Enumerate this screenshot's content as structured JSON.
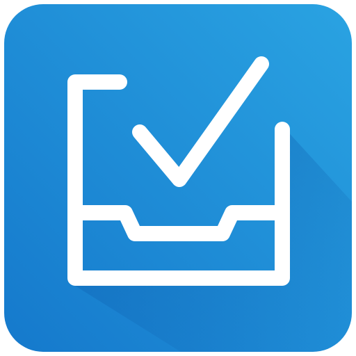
{
  "app_icon": {
    "name": "inbox-checkmark-app-icon",
    "glyph": "inbox-tray-with-checkmark",
    "colors": {
      "background_top_right": "#2aa3e2",
      "background_bottom_left": "#1579cc",
      "long_shadow": "#0e5fae",
      "glyph": "#ffffff"
    }
  }
}
